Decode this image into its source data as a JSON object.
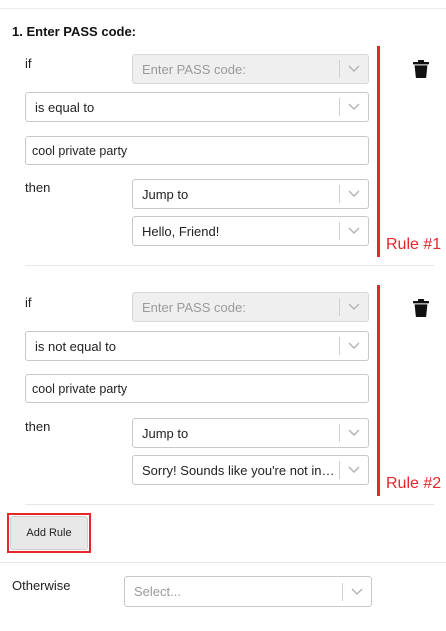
{
  "section": {
    "title": "1. Enter PASS code:"
  },
  "rules": [
    {
      "if_label": "if",
      "question_value": "Enter PASS code:",
      "condition_value": "is equal to",
      "answer_value": "cool private party",
      "then_label": "then",
      "action_value": "Jump to",
      "target_value": "Hello, Friend!",
      "annotation": "Rule #1"
    },
    {
      "if_label": "if",
      "question_value": "Enter PASS code:",
      "condition_value": "is not equal to",
      "answer_value": "cool private party",
      "then_label": "then",
      "action_value": "Jump to",
      "target_value": "Sorry! Sounds like you're not invited",
      "annotation": "Rule #2"
    }
  ],
  "add_rule": {
    "label": "Add Rule"
  },
  "otherwise": {
    "label": "Otherwise",
    "placeholder": "Select..."
  },
  "colors": {
    "annotation_red": "#e5262c",
    "disabled_bg": "#efefef",
    "border": "#c8c8c8"
  },
  "icons": {
    "delete": "trash-icon",
    "dropdown": "chevron-down-icon"
  }
}
